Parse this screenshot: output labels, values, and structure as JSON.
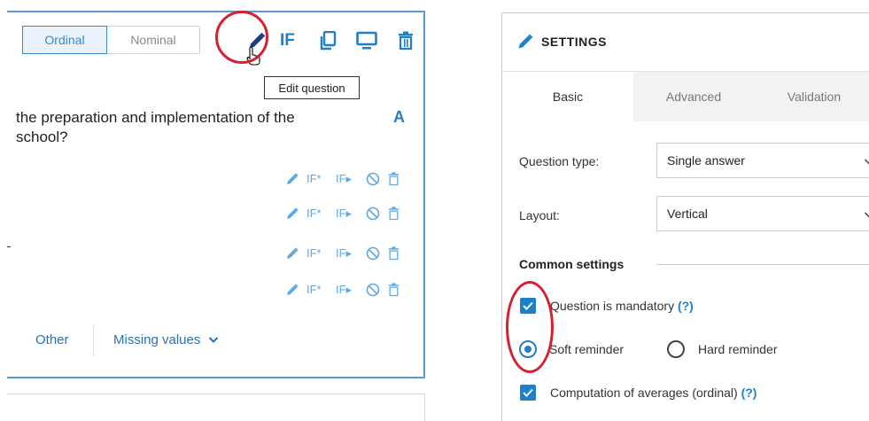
{
  "left_panel": {
    "scale_toggle": {
      "active": "Ordinal",
      "inactive": "Nominal"
    },
    "toolbar": {
      "if_label": "IF"
    },
    "tooltip": "Edit question",
    "question_text_line1": "the preparation and implementation of the",
    "question_text_line2": "school?",
    "font_icon": "A",
    "answer_rows": [
      {
        "if_star": "IF*",
        "if_arrow": "IF▸"
      },
      {
        "if_star": "IF*",
        "if_arrow": "IF▸"
      },
      {
        "if_star": "IF*",
        "if_arrow": "IF▸"
      },
      {
        "if_star": "IF*",
        "if_arrow": "IF▸"
      }
    ],
    "bottom_links": {
      "other": "Other",
      "missing": "Missing values"
    }
  },
  "settings": {
    "title": "SETTINGS",
    "tabs": [
      "Basic",
      "Advanced",
      "Validation"
    ],
    "question_type_label": "Question type:",
    "question_type_value": "Single answer",
    "layout_label": "Layout:",
    "layout_value": "Vertical",
    "common_heading": "Common settings",
    "mandatory_label": "Question is mandatory",
    "help_mark": "(?)",
    "soft_reminder": "Soft reminder",
    "hard_reminder": "Hard reminder",
    "averages_label": "Computation of averages (ordinal)",
    "help_mark_2": "(?)"
  },
  "colors": {
    "accent": "#1f7fc9",
    "highlight_circle": "#d62031"
  }
}
